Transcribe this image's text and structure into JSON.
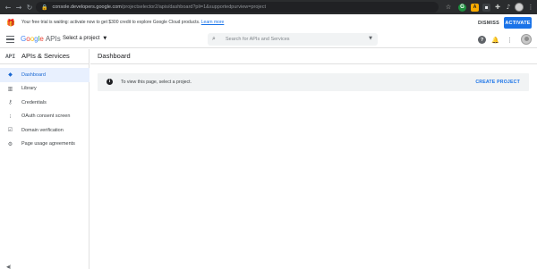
{
  "browser": {
    "url_host": "console.developers.google.com",
    "url_path": "/projectselector2/apis/dashboard?pli=1&supportedpurview=project",
    "extensions": [
      "star-icon",
      "g-extension-icon",
      "ai-extension-icon",
      "dark-extension-icon",
      "puzzle-icon",
      "music-icon"
    ]
  },
  "banner": {
    "message": "Your free trial is waiting: activate now to get $300 credit to explore Google Cloud products.",
    "learn_more": "Learn more",
    "dismiss_label": "DISMISS",
    "activate_label": "ACTIVATE"
  },
  "header": {
    "logo_google": [
      "G",
      "o",
      "o",
      "g",
      "l",
      "e"
    ],
    "logo_apis": "APIs",
    "project_select_label": "Select a project",
    "search_placeholder": "Search for APIs and Services"
  },
  "sidebar": {
    "api_badge": "API",
    "title": "APIs & Services",
    "items": [
      {
        "label": "Dashboard",
        "icon": "dashboard-icon",
        "active": true
      },
      {
        "label": "Library",
        "icon": "library-icon",
        "active": false
      },
      {
        "label": "Credentials",
        "icon": "key-icon",
        "active": false
      },
      {
        "label": "OAuth consent screen",
        "icon": "consent-icon",
        "active": false
      },
      {
        "label": "Domain verification",
        "icon": "checkbox-icon",
        "active": false
      },
      {
        "label": "Page usage agreements",
        "icon": "settings-list-icon",
        "active": false
      }
    ]
  },
  "main": {
    "title": "Dashboard",
    "notice_text": "To view this page, select a project.",
    "create_project_label": "CREATE PROJECT"
  },
  "colors": {
    "accent": "#1a73e8",
    "active_bg": "#e8f0fe",
    "notice_bg": "#f1f3f4",
    "chrome_bg": "#2a2c2e"
  }
}
